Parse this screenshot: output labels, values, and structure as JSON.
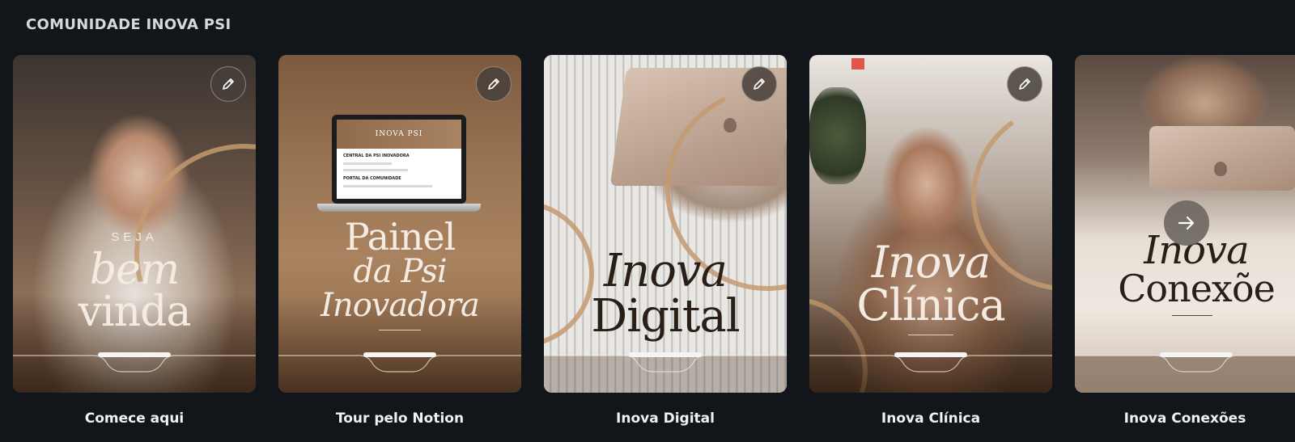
{
  "section": {
    "title": "COMUNIDADE INOVA PSI"
  },
  "cards": [
    {
      "label": "Comece aqui",
      "art": {
        "small": "SEJA",
        "line1": "bem",
        "line2": "vinda"
      }
    },
    {
      "label": "Tour pelo Notion",
      "art": {
        "line1": "Painel",
        "line2": "da Psi",
        "line3": "Inovadora"
      },
      "screen": {
        "hero": "INOVA PSI",
        "heading": "CENTRAL DA PSI INOVADORA",
        "sub": "PORTAL DA COMUNIDADE"
      }
    },
    {
      "label": "Inova Digital",
      "art": {
        "line1": "Inova",
        "line2": "Digital"
      }
    },
    {
      "label": "Inova Clínica",
      "art": {
        "line1": "Inova",
        "line2": "Clínica"
      }
    },
    {
      "label": "Inova Conexões",
      "art": {
        "line1": "Inova",
        "line2": "Conexõe"
      }
    }
  ],
  "icons": {
    "edit": "pencil-icon",
    "next": "arrow-right-icon"
  },
  "colors": {
    "background": "#12161a",
    "accent": "#c49a70",
    "label": "#f1f1f1"
  }
}
